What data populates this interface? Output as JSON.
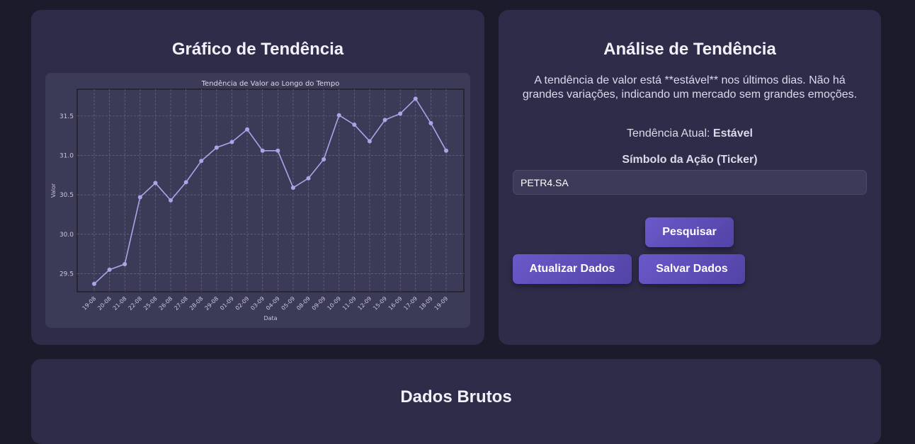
{
  "left_card": {
    "title": "Gráfico de Tendência"
  },
  "right_card": {
    "title": "Análise de Tendência",
    "description": "A tendência de valor está **estável** nos últimos dias. Não há grandes variações, indicando um mercado sem grandes emoções.",
    "current_label": "Tendência Atual:",
    "current_value": "Estável",
    "ticker_label": "Símbolo da Ação (Ticker)",
    "ticker_value": "PETR4.SA",
    "search_button": "Pesquisar",
    "update_button": "Atualizar Dados",
    "save_button": "Salvar Dados"
  },
  "bottom_card": {
    "title": "Dados Brutos"
  },
  "chart_data": {
    "type": "line",
    "title": "Tendência de Valor ao Longo do Tempo",
    "xlabel": "Data",
    "ylabel": "Valor",
    "categories": [
      "19-08",
      "20-08",
      "21-08",
      "22-08",
      "25-08",
      "26-08",
      "27-08",
      "28-08",
      "29-08",
      "01-09",
      "02-09",
      "03-09",
      "04-09",
      "05-09",
      "08-09",
      "09-09",
      "10-09",
      "11-09",
      "12-09",
      "15-09",
      "16-09",
      "17-09",
      "18-09",
      "19-09"
    ],
    "values": [
      29.37,
      29.55,
      29.62,
      30.47,
      30.65,
      30.43,
      30.66,
      30.93,
      31.1,
      31.17,
      31.33,
      31.06,
      31.06,
      30.59,
      30.71,
      30.95,
      31.51,
      31.39,
      31.18,
      31.45,
      31.53,
      31.72,
      31.41,
      31.06
    ],
    "yticks": [
      29.5,
      30.0,
      30.5,
      31.0,
      31.5
    ],
    "ylim": [
      29.27,
      31.84
    ],
    "grid": true,
    "line_color": "#a9a6e8"
  }
}
